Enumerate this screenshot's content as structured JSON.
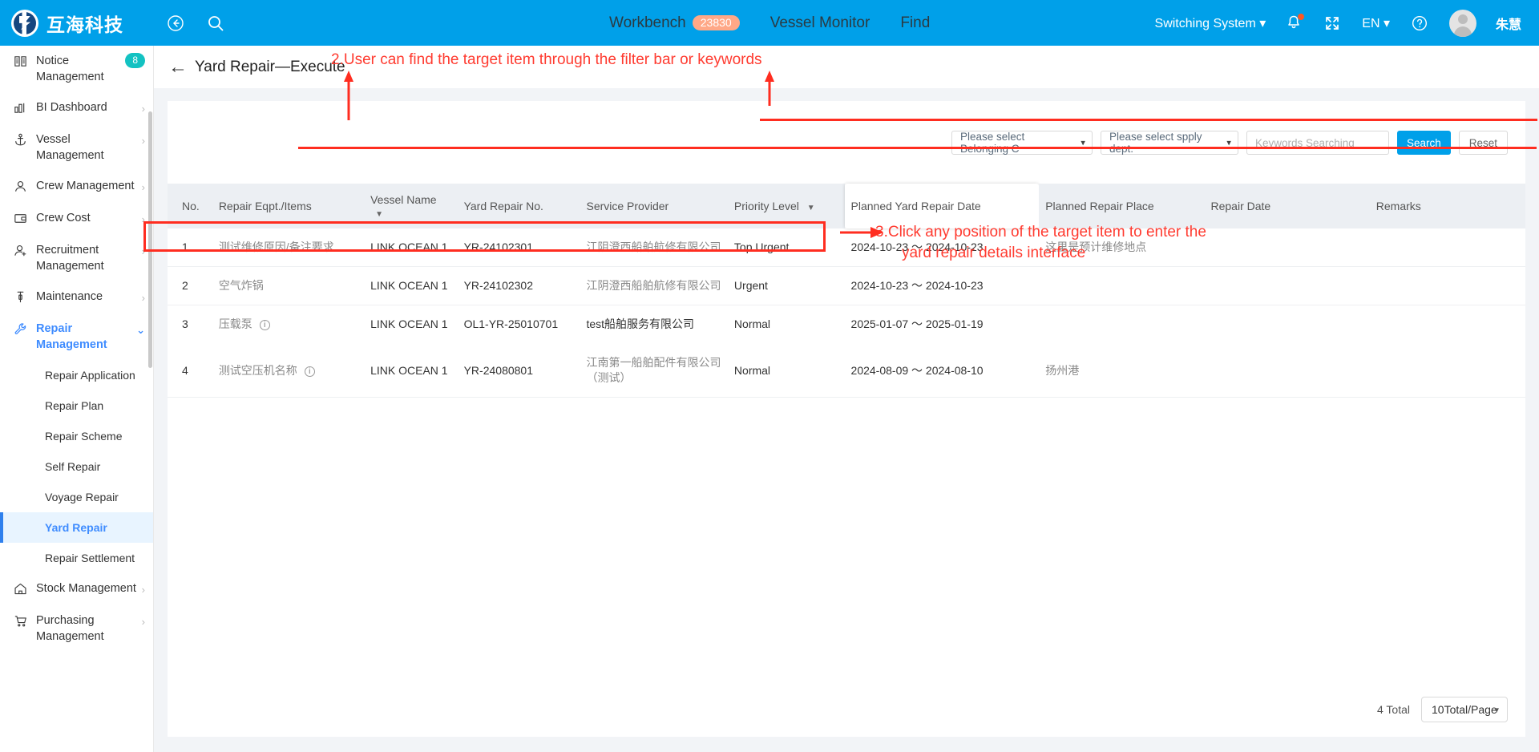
{
  "header": {
    "logo_text": "互海科技",
    "back_icon": "back-arrow-icon",
    "search_icon": "search-icon",
    "workbench_label": "Workbench",
    "workbench_count": "23830",
    "vessel_monitor_label": "Vessel Monitor",
    "find_label": "Find",
    "switching_system_label": "Switching System",
    "bell_icon": "bell-icon",
    "fullscreen_icon": "fullscreen-icon",
    "lang_label": "EN",
    "help_icon": "help-icon",
    "user_name": "朱慧",
    "bg_color": "#00a0e9"
  },
  "sidebar": {
    "items": [
      {
        "label": "Notice Management",
        "icon": "notice-icon",
        "badge": "8",
        "arrow": false
      },
      {
        "label": "BI Dashboard",
        "icon": "chart-icon",
        "arrow": true
      },
      {
        "label": "Vessel Management",
        "icon": "anchor-icon",
        "arrow": true
      },
      {
        "label": "Crew Management",
        "icon": "user-icon",
        "arrow": true
      },
      {
        "label": "Crew Cost",
        "icon": "wallet-icon",
        "arrow": true
      },
      {
        "label": "Recruitment Management",
        "icon": "user-plus-icon",
        "arrow": true
      },
      {
        "label": "Maintenance",
        "icon": "maintenance-icon",
        "arrow": true
      },
      {
        "label": "Repair Management",
        "icon": "wrench-icon",
        "arrow": true,
        "expanded": true
      }
    ],
    "repair_children": [
      {
        "label": "Repair Application",
        "active": false
      },
      {
        "label": "Repair Plan",
        "active": false
      },
      {
        "label": "Repair Scheme",
        "active": false
      },
      {
        "label": "Self Repair",
        "active": false
      },
      {
        "label": "Voyage Repair",
        "active": false
      },
      {
        "label": "Yard Repair",
        "active": true
      },
      {
        "label": "Repair Settlement",
        "active": false
      }
    ],
    "tail_items": [
      {
        "label": "Stock Management",
        "icon": "home-icon",
        "arrow": true
      },
      {
        "label": "Purchasing Management",
        "icon": "cart-icon",
        "arrow": true
      }
    ],
    "active_color": "#3f8cff"
  },
  "page": {
    "title": "Yard Repair—Execute",
    "back_icon": "left-arrow-icon"
  },
  "filters": {
    "belonging_company": "Please select Belonging C",
    "supply_dept": "Please select spply dept.",
    "keywords_placeholder": "Keywords Searching",
    "keywords_value": "",
    "search_label": "Search",
    "reset_label": "Reset",
    "search_btn_color": "#00a0e9"
  },
  "table": {
    "columns": [
      {
        "key": "no",
        "label": "No.",
        "sortable": false,
        "boxed": false
      },
      {
        "key": "items",
        "label": "Repair Eqpt./Items",
        "sortable": false,
        "boxed": false
      },
      {
        "key": "vessel",
        "label": "Vessel Name",
        "sortable": true,
        "boxed": false
      },
      {
        "key": "yrno",
        "label": "Yard Repair No.",
        "sortable": false,
        "boxed": false
      },
      {
        "key": "prov",
        "label": "Service Provider",
        "sortable": false,
        "boxed": false
      },
      {
        "key": "prio",
        "label": "Priority Level",
        "sortable": true,
        "boxed": false
      },
      {
        "key": "pdate",
        "label": "Planned Yard Repair Date",
        "sortable": false,
        "boxed": true
      },
      {
        "key": "place",
        "label": "Planned Repair Place",
        "sortable": false,
        "boxed": false
      },
      {
        "key": "rdate",
        "label": "Repair Date",
        "sortable": false,
        "boxed": false
      },
      {
        "key": "rem",
        "label": "Remarks",
        "sortable": false,
        "boxed": false
      }
    ],
    "rows": [
      {
        "no": "1",
        "items": "测试维修原因/备注要求",
        "items_info": false,
        "vessel": "LINK OCEAN 1",
        "yrno": "YR-24102301",
        "prov": "江阴澄西船舶航修有限公司",
        "prio": "Top Urgent",
        "pdate": "2024-10-23 ～ 2024-10-23",
        "place": "这里是预计维修地点",
        "rdate": "",
        "rem": "",
        "highlighted": false
      },
      {
        "no": "2",
        "items": "空气炸锅",
        "items_info": false,
        "vessel": "LINK OCEAN 1",
        "yrno": "YR-24102302",
        "prov": "江阴澄西船舶航修有限公司",
        "prio": "Urgent",
        "pdate": "2024-10-23 ～ 2024-10-23",
        "place": "",
        "rdate": "",
        "rem": "",
        "highlighted": false
      },
      {
        "no": "3",
        "items": "压载泵",
        "items_info": true,
        "vessel": "LINK OCEAN 1",
        "yrno": "OL1-YR-25010701",
        "prov": "test船舶服务有限公司",
        "prio": "Normal",
        "pdate": "2025-01-07 ～ 2025-01-19",
        "place": "",
        "rdate": "",
        "rem": "",
        "highlighted": true
      },
      {
        "no": "4",
        "items": "测试空压机名称",
        "items_info": true,
        "vessel": "LINK OCEAN 1",
        "yrno": "YR-24080801",
        "prov": "江南第一船舶配件有限公司（测试）",
        "prio": "Normal",
        "pdate": "2024-08-09 ～ 2024-08-10",
        "place": "扬州港",
        "rdate": "",
        "rem": "",
        "highlighted": false
      }
    ]
  },
  "pagination": {
    "total_label": "4 Total",
    "page_size_label": "10Total/Page"
  },
  "annotations": {
    "color": "#ff3b30",
    "step2": "2.User can find the target item through the filter bar or keywords",
    "step3_line1": "3.Click any position of the target item to enter the",
    "step3_line2": "yard repair details interface"
  }
}
